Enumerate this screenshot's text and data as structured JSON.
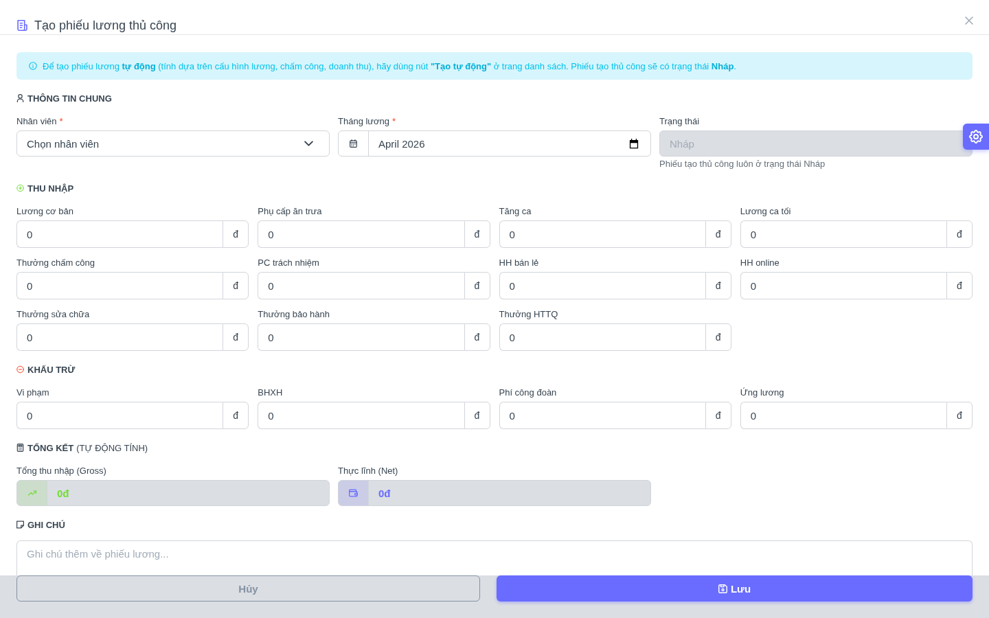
{
  "dialog": {
    "title": "Tạo phiếu lương thủ công"
  },
  "alert": {
    "text": "Để tạo phiếu lương **tự động** (tính dựa trên cấu hình lương, chấm công, doanh thu), hãy dùng nút **\"Tạo tự động\"** ở trang danh sách. Phiếu tạo thủ công sẽ có trạng thái **Nháp**."
  },
  "sections": [
    {
      "kind": "general",
      "title": "THÔNG TIN CHUNG",
      "fields": [
        {
          "kind": "select",
          "label": "Nhân viên",
          "required_mark": "*",
          "value": "Chọn nhân viên",
          "disabled": false
        },
        {
          "kind": "month",
          "label": "Tháng lương",
          "required_mark": "*",
          "value": "April 2026",
          "disabled": false
        },
        {
          "kind": "text",
          "label": "Trạng thái",
          "value": "Nháp",
          "disabled": true,
          "help": "Phiếu tạo thủ công luôn ở trạng thái Nháp"
        }
      ]
    },
    {
      "kind": "income",
      "title": "THU NHẬP",
      "fields": [
        {
          "kind": "currency",
          "label": "Lương cơ bản",
          "value": "0",
          "unit": "đ"
        },
        {
          "kind": "currency",
          "label": "Phụ cấp ăn trưa",
          "value": "0",
          "unit": "đ"
        },
        {
          "kind": "currency",
          "label": "Tăng ca",
          "value": "0",
          "unit": "đ"
        },
        {
          "kind": "currency",
          "label": "Lương ca tối",
          "value": "0",
          "unit": "đ"
        },
        {
          "kind": "currency",
          "label": "Thưởng chấm công",
          "value": "0",
          "unit": "đ"
        },
        {
          "kind": "currency",
          "label": "PC trách nhiệm",
          "value": "0",
          "unit": "đ"
        },
        {
          "kind": "currency",
          "label": "HH bán lẻ",
          "value": "0",
          "unit": "đ"
        },
        {
          "kind": "currency",
          "label": "HH online",
          "value": "0",
          "unit": "đ"
        },
        {
          "kind": "currency",
          "label": "Thưởng sửa chữa",
          "value": "0",
          "unit": "đ"
        },
        {
          "kind": "currency",
          "label": "Thưởng bảo hành",
          "value": "0",
          "unit": "đ"
        },
        {
          "kind": "currency",
          "label": "Thưởng HTTQ",
          "value": "0",
          "unit": "đ"
        }
      ]
    },
    {
      "kind": "deduction",
      "title": "KHẤU TRỪ",
      "fields": [
        {
          "kind": "currency",
          "label": "Vi phạm",
          "value": "0",
          "unit": "đ"
        },
        {
          "kind": "currency",
          "label": "BHXH",
          "value": "0",
          "unit": "đ"
        },
        {
          "kind": "currency",
          "label": "Phí công đoàn",
          "value": "0",
          "unit": "đ"
        },
        {
          "kind": "currency",
          "label": "Ứng lương",
          "value": "0",
          "unit": "đ"
        }
      ]
    },
    {
      "kind": "summary",
      "title": "TỔNG KẾT",
      "note": "(TỰ ĐỘNG TÍNH)",
      "fields": [
        {
          "kind": "gross",
          "label": "Tổng thu nhập (Gross)",
          "value": "0đ",
          "color": "#71dd37",
          "disabled": true
        },
        {
          "kind": "net",
          "label": "Thực lĩnh (Net)",
          "value": "0đ",
          "color": "#696cff",
          "disabled": true
        }
      ]
    },
    {
      "kind": "notes",
      "title": "GHI CHÚ",
      "fields": [
        {
          "kind": "textarea",
          "placeholder": "Ghi chú thêm về phiếu lương..."
        }
      ]
    }
  ],
  "buttons": [
    {
      "kind": "secondary",
      "label": "Hủy"
    },
    {
      "kind": "primary",
      "label": "Lưu"
    }
  ]
}
